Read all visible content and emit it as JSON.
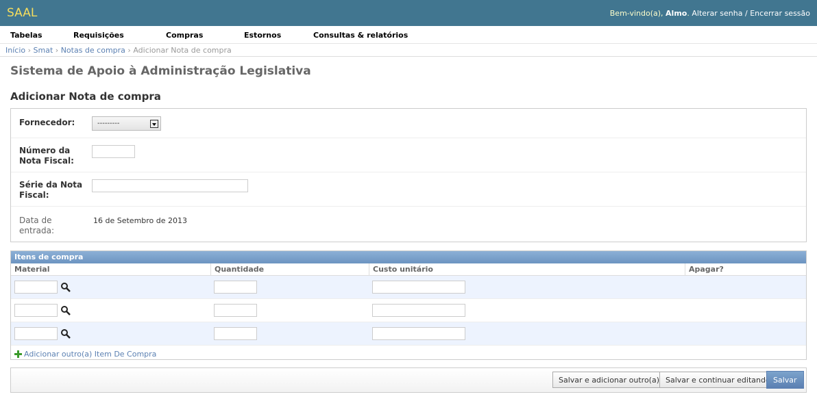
{
  "header": {
    "brand": "SAAL",
    "welcome": "Bem-vindo(a),",
    "user": "Almo",
    "change_password": "Alterar senha",
    "separator": "/",
    "logout": "Encerrar sessão"
  },
  "menu": [
    "Tabelas",
    "Requisições",
    "Compras",
    "Estornos",
    "Consultas & relatórios"
  ],
  "breadcrumbs": {
    "items": [
      "Início",
      "Smat",
      "Notas de compra"
    ],
    "current": "Adicionar Nota de compra",
    "sep": "›"
  },
  "site_title": "Sistema de Apoio à Administração Legislativa",
  "page_title": "Adicionar Nota de compra",
  "form": {
    "fornecedor_label": "Fornecedor:",
    "fornecedor_value": "---------",
    "numero_label_1": "Número da",
    "numero_label_2": "Nota Fiscal:",
    "serie_label_1": "Série da Nota",
    "serie_label_2": "Fiscal:",
    "data_label_1": "Data de",
    "data_label_2": "entrada:",
    "data_value": "16 de Setembro de 2013"
  },
  "inline": {
    "title": "Itens de compra",
    "columns": [
      "Material",
      "Quantidade",
      "Custo unitário",
      "Apagar?"
    ],
    "add_link": "Adicionar outro(a) Item De Compra"
  },
  "buttons": {
    "save_add": "Salvar e adicionar outro(a)",
    "save_continue": "Salvar e continuar editando",
    "save": "Salvar"
  },
  "colors": {
    "header_bg": "#417690",
    "brand": "#f5dd5d",
    "link": "#5b80b2",
    "inline_header": "#7ca0c7",
    "alt_row": "#edf3fe"
  },
  "icons": {
    "lookup": "magnifier-icon",
    "add": "plus-icon",
    "dropdown": "chevron-down-icon"
  }
}
